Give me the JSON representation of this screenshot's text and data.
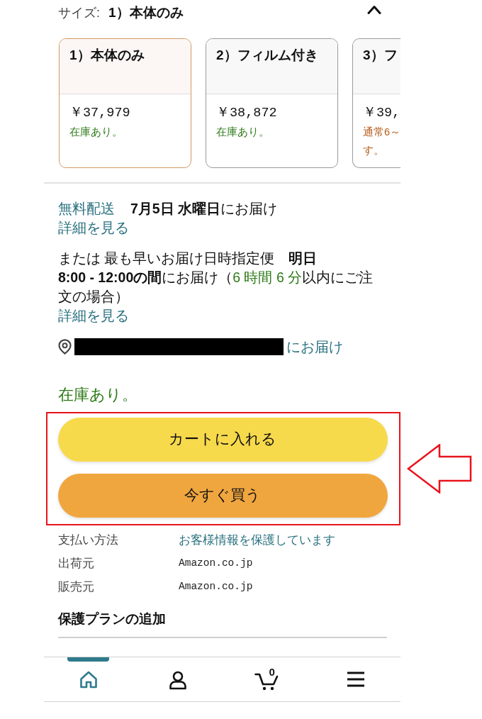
{
  "size_selector": {
    "label": "サイズ:",
    "value": "1）本体のみ",
    "expanded": true
  },
  "size_options": [
    {
      "kind": "in_stock",
      "title": "1）本体のみ",
      "price": "￥37,979",
      "availability": [
        "在庫あり。"
      ],
      "selected": true
    },
    {
      "kind": "in_stock",
      "title": "2）フィルム付き",
      "price": "￥38,872",
      "availability": [
        "在庫あり。"
      ],
      "selected": false
    },
    {
      "kind": "ships_later",
      "title": "3）フ",
      "price": "￥39,",
      "availability": [
        "通常6～",
        "す。"
      ],
      "selected": false
    }
  ],
  "delivery": {
    "free_shipping_link": "無料配送",
    "date_text": "**7月5日 水曜日**にお届け",
    "details_link": "詳細を見る"
  },
  "express_delivery": {
    "segments": [
      {
        "kind": "plain",
        "text": "または 最も早いお届け日時指定便　**明日** **8:00 - 12:00の間**にお届け（"
      },
      {
        "kind": "countdown",
        "text": "6 時間 6 分"
      },
      {
        "kind": "plain",
        "text": "以内にご注文の場合）"
      }
    ],
    "details_link": "詳細を見る"
  },
  "address": {
    "redacted": true,
    "suffix_link": "にお届け"
  },
  "availability": "在庫あり。",
  "buttons": [
    {
      "kind": "add_to_cart",
      "label": "カートに入れる"
    },
    {
      "kind": "buy_now",
      "label": "今すぐ買う"
    }
  ],
  "info_rows": [
    {
      "label": "支払い方法",
      "value": "お客様情報を保護しています",
      "kind": "link"
    },
    {
      "label": "出荷元",
      "value": "Amazon.co.jp",
      "kind": "plain"
    },
    {
      "label": "販売元",
      "value": "Amazon.co.jp",
      "kind": "plain"
    }
  ],
  "protection_plan": {
    "heading": "保護プランの追加"
  },
  "bottom_nav": [
    {
      "kind": "home",
      "selected": true
    },
    {
      "kind": "account",
      "selected": false
    },
    {
      "kind": "cart",
      "selected": false,
      "count": "0"
    },
    {
      "kind": "menu",
      "selected": false
    }
  ]
}
